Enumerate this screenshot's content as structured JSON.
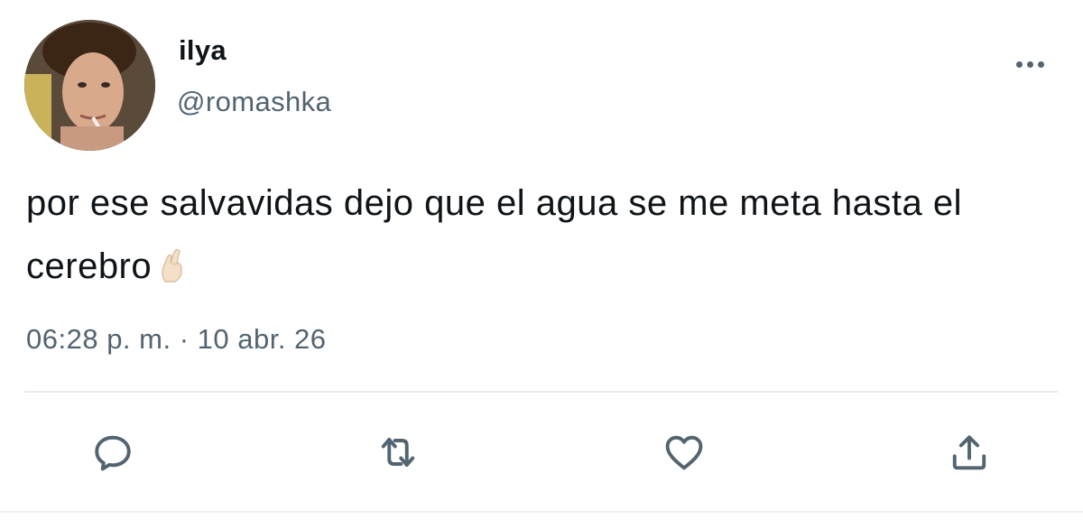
{
  "author": {
    "display_name": "ilya",
    "handle": "@romashka",
    "avatar_icon": "profile-photo"
  },
  "tweet": {
    "text": "por ese salvavidas dejo que el agua se me meta hasta el cerebro",
    "emoji": "crossed-fingers",
    "timestamp": "06:28 p. m. · 10 abr. 26"
  },
  "actions": [
    {
      "icon": "reply-icon"
    },
    {
      "icon": "retweet-icon"
    },
    {
      "icon": "like-icon"
    },
    {
      "icon": "share-icon"
    }
  ],
  "colors": {
    "text_primary": "#0f1419",
    "text_secondary": "#536471",
    "icon": "#536471",
    "divider": "#e6ecf0"
  }
}
